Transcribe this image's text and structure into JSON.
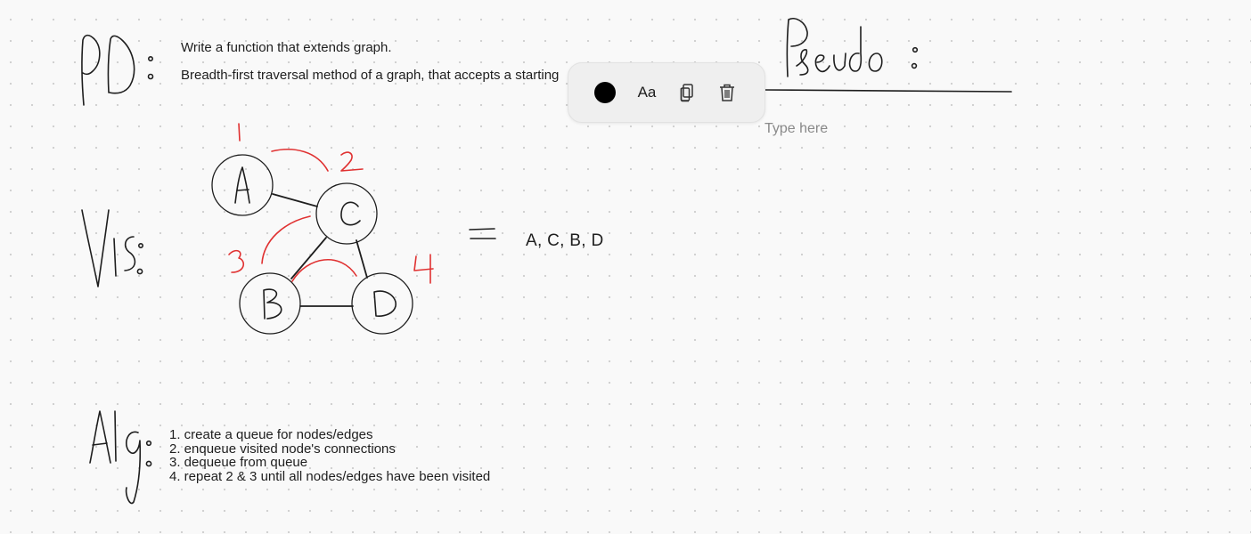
{
  "board": {
    "heading_pp": "PD:",
    "heading_vis": "Vis:",
    "heading_alg": "Alg:",
    "heading_pseudo": "Pseudo:"
  },
  "problem": {
    "line1": "Write a function that extends graph.",
    "line2": "Breadth-first traversal method of a graph, that accepts a starting"
  },
  "graph": {
    "nodes": [
      "A",
      "C",
      "B",
      "D"
    ],
    "visit_numbers": [
      "1",
      "2",
      "3",
      "4"
    ],
    "equals": "=",
    "result": "A, C, B, D"
  },
  "algorithm": {
    "steps": [
      "1. create a queue for nodes/edges",
      "2. enqueue visited node's connections",
      "3. dequeue from queue",
      "4. repeat 2 & 3 until all nodes/edges have been visited"
    ]
  },
  "toolbar": {
    "color_value": "#000000",
    "font_label": "Aa",
    "copy_icon": "copy-icon",
    "delete_icon": "trash-icon"
  },
  "pseudo_input": {
    "placeholder": "Type here",
    "value": ""
  },
  "colors": {
    "ink": "#1e1e1e",
    "annotation": "#e03131",
    "background": "#f9f9f9"
  }
}
